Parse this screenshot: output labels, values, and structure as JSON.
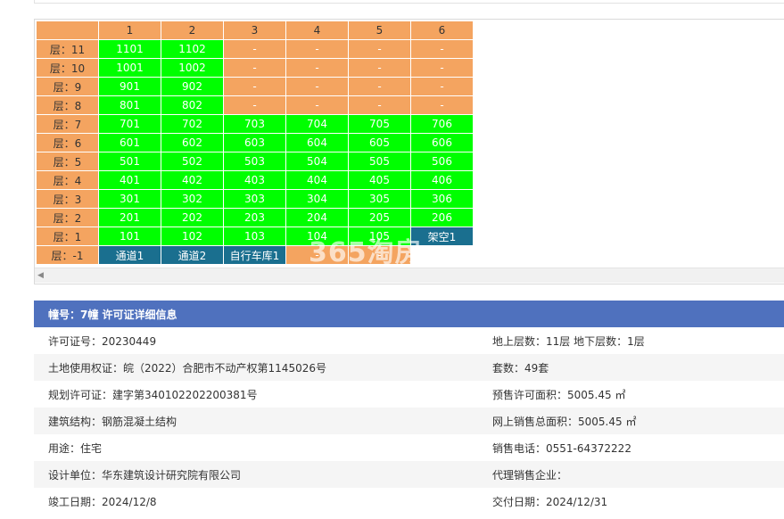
{
  "grid": {
    "header": [
      "",
      "1",
      "2",
      "3",
      "4",
      "5",
      "6"
    ],
    "rows": [
      {
        "label": "层：11",
        "cells": [
          {
            "t": "1101",
            "s": "green"
          },
          {
            "t": "1102",
            "s": "green"
          },
          {
            "t": "-",
            "s": "empty"
          },
          {
            "t": "-",
            "s": "empty"
          },
          {
            "t": "-",
            "s": "empty"
          },
          {
            "t": "-",
            "s": "empty"
          }
        ]
      },
      {
        "label": "层：10",
        "cells": [
          {
            "t": "1001",
            "s": "green"
          },
          {
            "t": "1002",
            "s": "green"
          },
          {
            "t": "-",
            "s": "empty"
          },
          {
            "t": "-",
            "s": "empty"
          },
          {
            "t": "-",
            "s": "empty"
          },
          {
            "t": "-",
            "s": "empty"
          }
        ]
      },
      {
        "label": "层：9",
        "cells": [
          {
            "t": "901",
            "s": "green"
          },
          {
            "t": "902",
            "s": "green"
          },
          {
            "t": "-",
            "s": "empty"
          },
          {
            "t": "-",
            "s": "empty"
          },
          {
            "t": "-",
            "s": "empty"
          },
          {
            "t": "-",
            "s": "empty"
          }
        ]
      },
      {
        "label": "层：8",
        "cells": [
          {
            "t": "801",
            "s": "green"
          },
          {
            "t": "802",
            "s": "green"
          },
          {
            "t": "-",
            "s": "empty"
          },
          {
            "t": "-",
            "s": "empty"
          },
          {
            "t": "-",
            "s": "empty"
          },
          {
            "t": "-",
            "s": "empty"
          }
        ]
      },
      {
        "label": "层：7",
        "cells": [
          {
            "t": "701",
            "s": "green"
          },
          {
            "t": "702",
            "s": "green"
          },
          {
            "t": "703",
            "s": "green"
          },
          {
            "t": "704",
            "s": "green"
          },
          {
            "t": "705",
            "s": "green"
          },
          {
            "t": "706",
            "s": "green"
          }
        ]
      },
      {
        "label": "层：6",
        "cells": [
          {
            "t": "601",
            "s": "green"
          },
          {
            "t": "602",
            "s": "green"
          },
          {
            "t": "603",
            "s": "green"
          },
          {
            "t": "604",
            "s": "green"
          },
          {
            "t": "605",
            "s": "green"
          },
          {
            "t": "606",
            "s": "green"
          }
        ]
      },
      {
        "label": "层：5",
        "cells": [
          {
            "t": "501",
            "s": "green"
          },
          {
            "t": "502",
            "s": "green"
          },
          {
            "t": "503",
            "s": "green"
          },
          {
            "t": "504",
            "s": "green"
          },
          {
            "t": "505",
            "s": "green"
          },
          {
            "t": "506",
            "s": "green"
          }
        ]
      },
      {
        "label": "层：4",
        "cells": [
          {
            "t": "401",
            "s": "green"
          },
          {
            "t": "402",
            "s": "green"
          },
          {
            "t": "403",
            "s": "green"
          },
          {
            "t": "404",
            "s": "green"
          },
          {
            "t": "405",
            "s": "green"
          },
          {
            "t": "406",
            "s": "green"
          }
        ]
      },
      {
        "label": "层：3",
        "cells": [
          {
            "t": "301",
            "s": "green"
          },
          {
            "t": "302",
            "s": "green"
          },
          {
            "t": "303",
            "s": "green"
          },
          {
            "t": "304",
            "s": "green"
          },
          {
            "t": "305",
            "s": "green"
          },
          {
            "t": "306",
            "s": "green"
          }
        ]
      },
      {
        "label": "层：2",
        "cells": [
          {
            "t": "201",
            "s": "green"
          },
          {
            "t": "202",
            "s": "green"
          },
          {
            "t": "203",
            "s": "green"
          },
          {
            "t": "204",
            "s": "green"
          },
          {
            "t": "205",
            "s": "green"
          },
          {
            "t": "206",
            "s": "green"
          }
        ]
      },
      {
        "label": "层：1",
        "cells": [
          {
            "t": "101",
            "s": "green"
          },
          {
            "t": "102",
            "s": "green"
          },
          {
            "t": "103",
            "s": "green"
          },
          {
            "t": "104",
            "s": "green"
          },
          {
            "t": "105",
            "s": "green"
          },
          {
            "t": "架空1",
            "s": "blue"
          }
        ]
      },
      {
        "label": "层：-1",
        "cells": [
          {
            "t": "通道1",
            "s": "blue"
          },
          {
            "t": "通道2",
            "s": "blue"
          },
          {
            "t": "自行车库1",
            "s": "blue"
          },
          {
            "t": "-",
            "s": "empty"
          },
          {
            "t": "-",
            "s": "empty"
          },
          {
            "t": "",
            "s": "dash-blank"
          }
        ]
      }
    ]
  },
  "watermark": "365淘房",
  "info": {
    "title": "幢号：7幢 许可证详细信息",
    "rows": [
      {
        "left": "许可证号：20230449",
        "right": "地上层数：11层  地下层数：1层"
      },
      {
        "left": "土地使用权证：皖（2022）合肥市不动产权第1145026号",
        "right": "套数：49套"
      },
      {
        "left": "规划许可证：建字第340102202200381号",
        "right": "预售许可面积：5005.45 ㎡"
      },
      {
        "left": "建筑结构：钢筋混凝土结构",
        "right": "网上销售总面积：5005.45 ㎡"
      },
      {
        "left": "用途：住宅",
        "right": "销售电话：0551-64372222"
      },
      {
        "left": "设计单位：华东建筑设计研究院有限公司",
        "right": "代理销售企业："
      },
      {
        "left": "竣工日期：2024/12/8",
        "right": "交付日期：2024/12/31"
      }
    ]
  },
  "colors": {
    "sold_green": "#00ff00",
    "unavailable_orange": "#f4a460",
    "special_blue": "#1a6f8f",
    "header_blue": "#4f71be"
  }
}
